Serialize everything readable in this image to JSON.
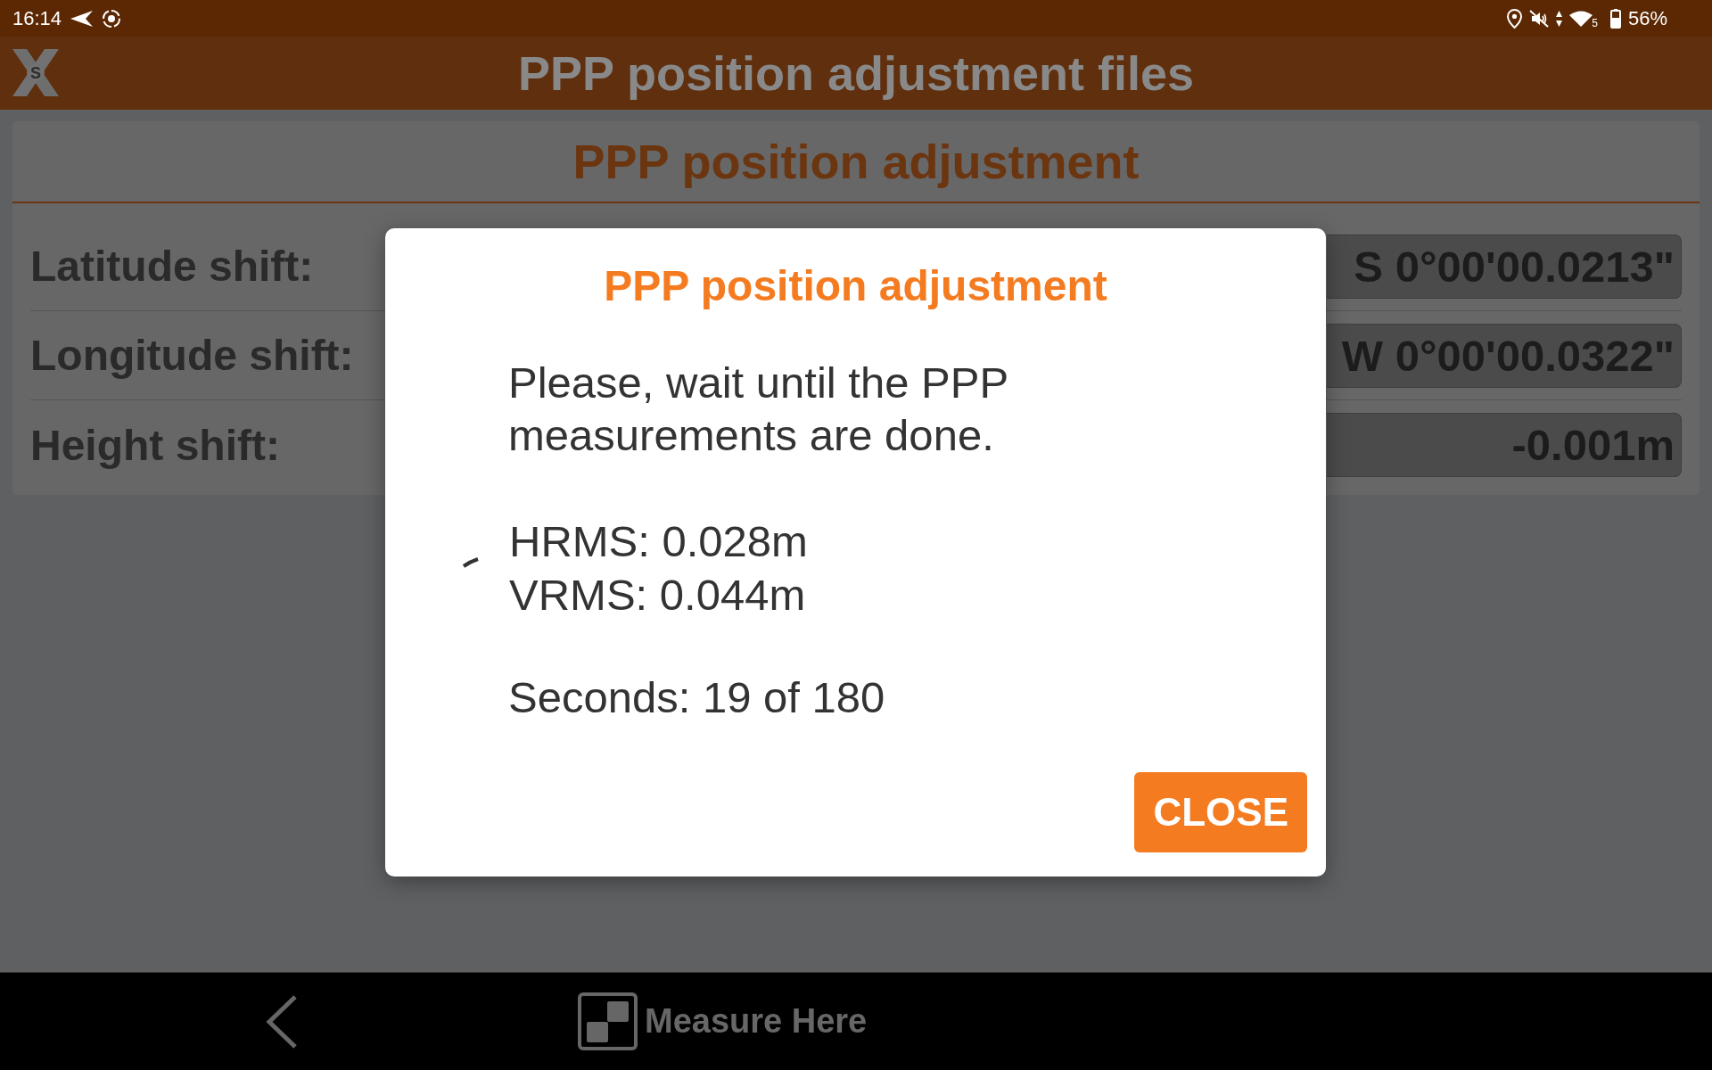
{
  "status_bar": {
    "time": "16:14",
    "network_label": "5",
    "battery": "56%"
  },
  "app_bar": {
    "logo_letter": "S",
    "title": "PPP position adjustment files"
  },
  "panel": {
    "title": "PPP position adjustment",
    "rows": [
      {
        "label": "Latitude shift:",
        "value": "S 0°00'00.0213\""
      },
      {
        "label": "Longitude shift:",
        "value": "W 0°00'00.0322\""
      },
      {
        "label": "Height shift:",
        "value": "-0.001m"
      }
    ]
  },
  "dialog": {
    "title": "PPP position adjustment",
    "message": "Please, wait until the PPP measurements are done.",
    "hrms": "HRMS: 0.028m",
    "vrms": "VRMS: 0.044m",
    "seconds": "Seconds: 19 of 180",
    "buttons": [
      "CLOSE"
    ]
  },
  "nav_bar": {
    "measure_button": "Measure Here"
  }
}
